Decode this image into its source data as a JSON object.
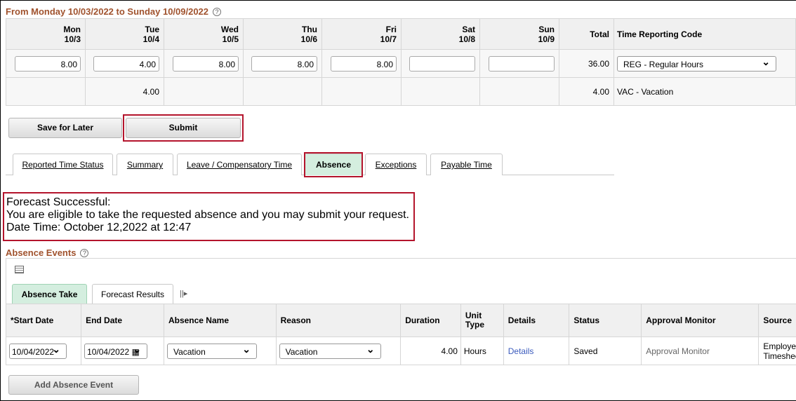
{
  "period_title": "From Monday 10/03/2022 to Sunday 10/09/2022",
  "timesheet": {
    "days": [
      {
        "d": "Mon",
        "dt": "10/3"
      },
      {
        "d": "Tue",
        "dt": "10/4"
      },
      {
        "d": "Wed",
        "dt": "10/5"
      },
      {
        "d": "Thu",
        "dt": "10/6"
      },
      {
        "d": "Fri",
        "dt": "10/7"
      },
      {
        "d": "Sat",
        "dt": "10/8"
      },
      {
        "d": "Sun",
        "dt": "10/9"
      }
    ],
    "total_header": "Total",
    "trc_header": "Time Reporting Code",
    "row1": {
      "values": [
        "8.00",
        "4.00",
        "8.00",
        "8.00",
        "8.00",
        "",
        ""
      ],
      "total": "36.00",
      "trc": "REG - Regular Hours"
    },
    "row2": {
      "values": [
        "",
        "4.00",
        "",
        "",
        "",
        "",
        ""
      ],
      "total": "4.00",
      "trc": "VAC - Vacation"
    }
  },
  "buttons": {
    "save_for_later": "Save for Later",
    "submit": "Submit",
    "add_absence_event": "Add Absence Event"
  },
  "tabs": [
    "Reported Time Status",
    "Summary",
    "Leave / Compensatory Time",
    "Absence",
    "Exceptions",
    "Payable Time"
  ],
  "active_tab": "Absence",
  "forecast": {
    "line1": "Forecast Successful:",
    "line2": "You are eligible to take the requested absence and you may submit your request.",
    "line3": "Date Time: October 12,2022 at 12:47"
  },
  "absence_events": {
    "title": "Absence Events",
    "subtabs": [
      "Absence Take",
      "Forecast Results"
    ],
    "columns": [
      "*Start Date",
      "End Date",
      "Absence Name",
      "Reason",
      "Duration",
      "Unit Type",
      "Details",
      "Status",
      "Approval Monitor",
      "Source"
    ],
    "rows": [
      {
        "start": "10/04/2022",
        "end": "10/04/2022",
        "name": "Vacation",
        "reason": "Vacation",
        "duration": "4.00",
        "unit": "Hours",
        "details": "Details",
        "status": "Saved",
        "approval": "Approval Monitor",
        "source": "Employee Timesheet"
      }
    ]
  },
  "colors": {
    "accent_red": "#b4142c",
    "active_tab": "#d4eedf",
    "title": "#a0522d"
  }
}
